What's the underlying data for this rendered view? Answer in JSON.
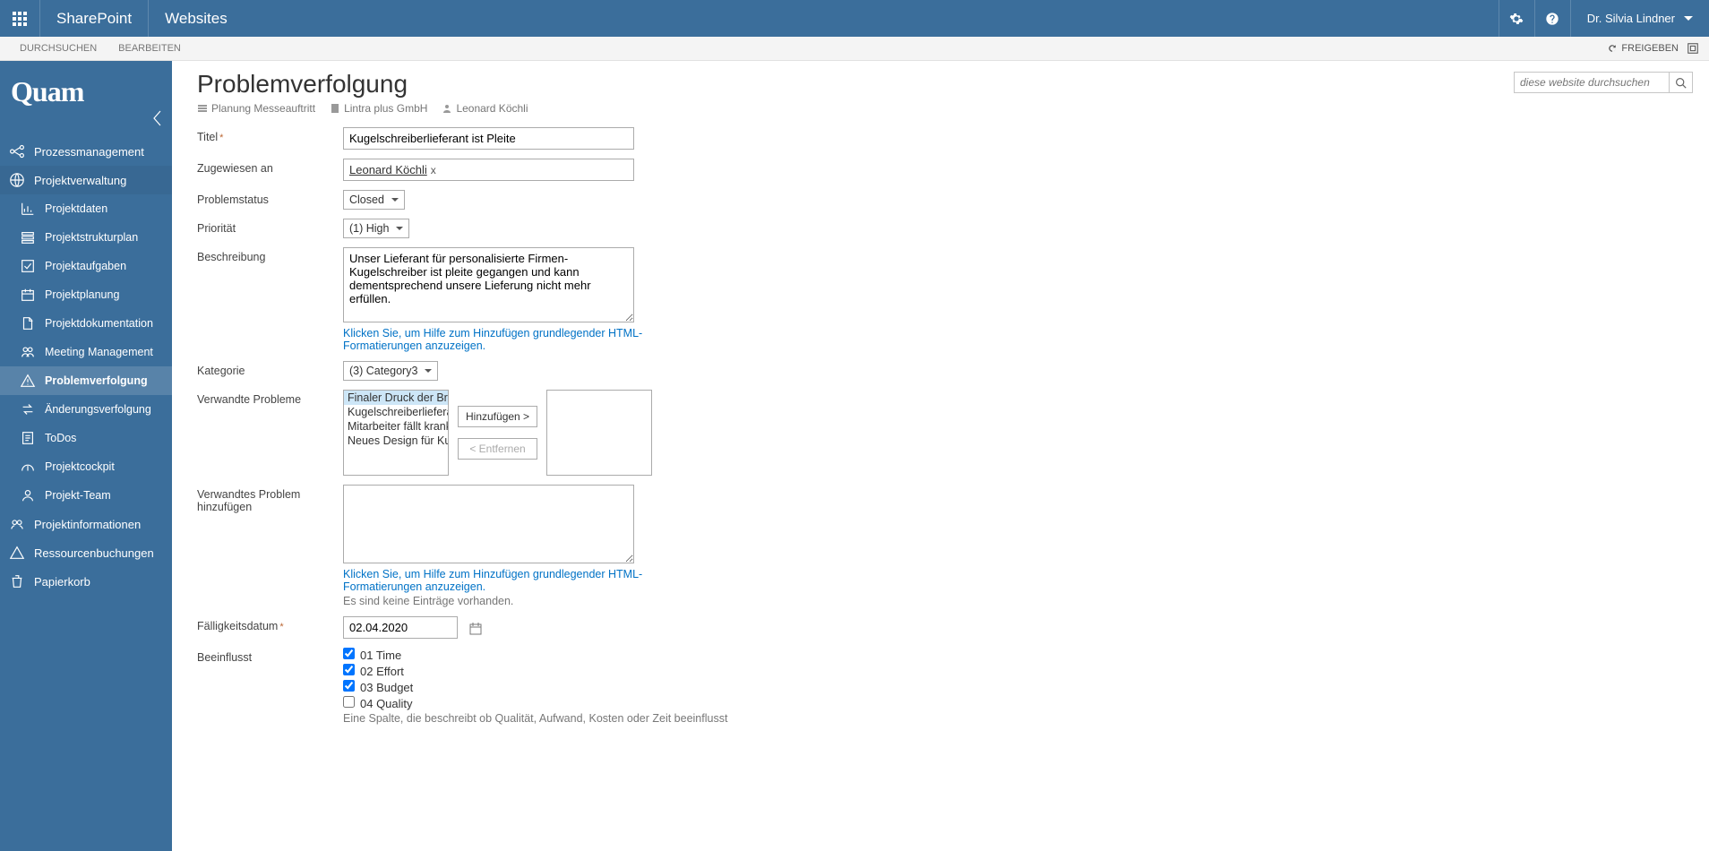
{
  "header": {
    "product": "SharePoint",
    "section": "Websites",
    "user": "Dr. Silvia Lindner"
  },
  "ribbon": {
    "tabs": [
      "DURCHSUCHEN",
      "BEARBEITEN"
    ],
    "share": "FREIGEBEN"
  },
  "sidebar": {
    "logo": "Quam",
    "top": [
      {
        "label": "Prozessmanagement"
      },
      {
        "label": "Projektverwaltung"
      }
    ],
    "sub": [
      {
        "label": "Projektdaten"
      },
      {
        "label": "Projektstrukturplan"
      },
      {
        "label": "Projektaufgaben"
      },
      {
        "label": "Projektplanung"
      },
      {
        "label": "Projektdokumentation"
      },
      {
        "label": "Meeting Management"
      },
      {
        "label": "Problemverfolgung"
      },
      {
        "label": "Änderungsverfolgung"
      },
      {
        "label": "ToDos"
      },
      {
        "label": "Projektcockpit"
      },
      {
        "label": "Projekt-Team"
      }
    ],
    "bottom": [
      {
        "label": "Projektinformationen"
      },
      {
        "label": "Ressourcenbuchungen"
      },
      {
        "label": "Papierkorb"
      }
    ]
  },
  "search": {
    "placeholder": "diese website durchsuchen"
  },
  "page": {
    "title": "Problemverfolgung",
    "crumbs": [
      "Planung Messeauftritt",
      "Lintra plus GmbH",
      "Leonard Köchli"
    ]
  },
  "form": {
    "labels": {
      "titel": "Titel",
      "zugewiesen": "Zugewiesen an",
      "status": "Problemstatus",
      "prio": "Priorität",
      "beschreibung": "Beschreibung",
      "kategorie": "Kategorie",
      "verwandte": "Verwandte Probleme",
      "verwandtes_add": "Verwandtes Problem hinzufügen",
      "faellig": "Fälligkeitsdatum",
      "beeinflusst": "Beeinflusst"
    },
    "titel": "Kugelschreiberlieferant ist Pleite",
    "zugewiesen": "Leonard Köchli",
    "status": "Closed",
    "prio": "(1) High",
    "beschreibung": "Unser Lieferant für personalisierte Firmen-Kugelschreiber ist pleite gegangen und kann dementsprechend unsere Lieferung nicht mehr erfüllen.",
    "kategorie": "(3) Category3",
    "verwandte_options": [
      "Finaler Druck der Broschüren",
      "Kugelschreiberlieferant",
      "Mitarbeiter fällt krank",
      "Neues Design für Kugelschreiber"
    ],
    "btn_add": "Hinzufügen >",
    "btn_remove": "< Entfernen",
    "help_link": "Klicken Sie, um Hilfe zum Hinzufügen grundlegender HTML-Formatierungen anzuzeigen.",
    "no_entries": "Es sind keine Einträge vorhanden.",
    "faellig": "02.04.2020",
    "beeinflusst_opts": [
      {
        "label": "01 Time",
        "checked": true
      },
      {
        "label": "02 Effort",
        "checked": true
      },
      {
        "label": "03 Budget",
        "checked": true
      },
      {
        "label": "04 Quality",
        "checked": false
      }
    ],
    "beeinflusst_note": "Eine Spalte, die beschreibt ob Qualität, Aufwand, Kosten oder Zeit beeinflusst"
  }
}
